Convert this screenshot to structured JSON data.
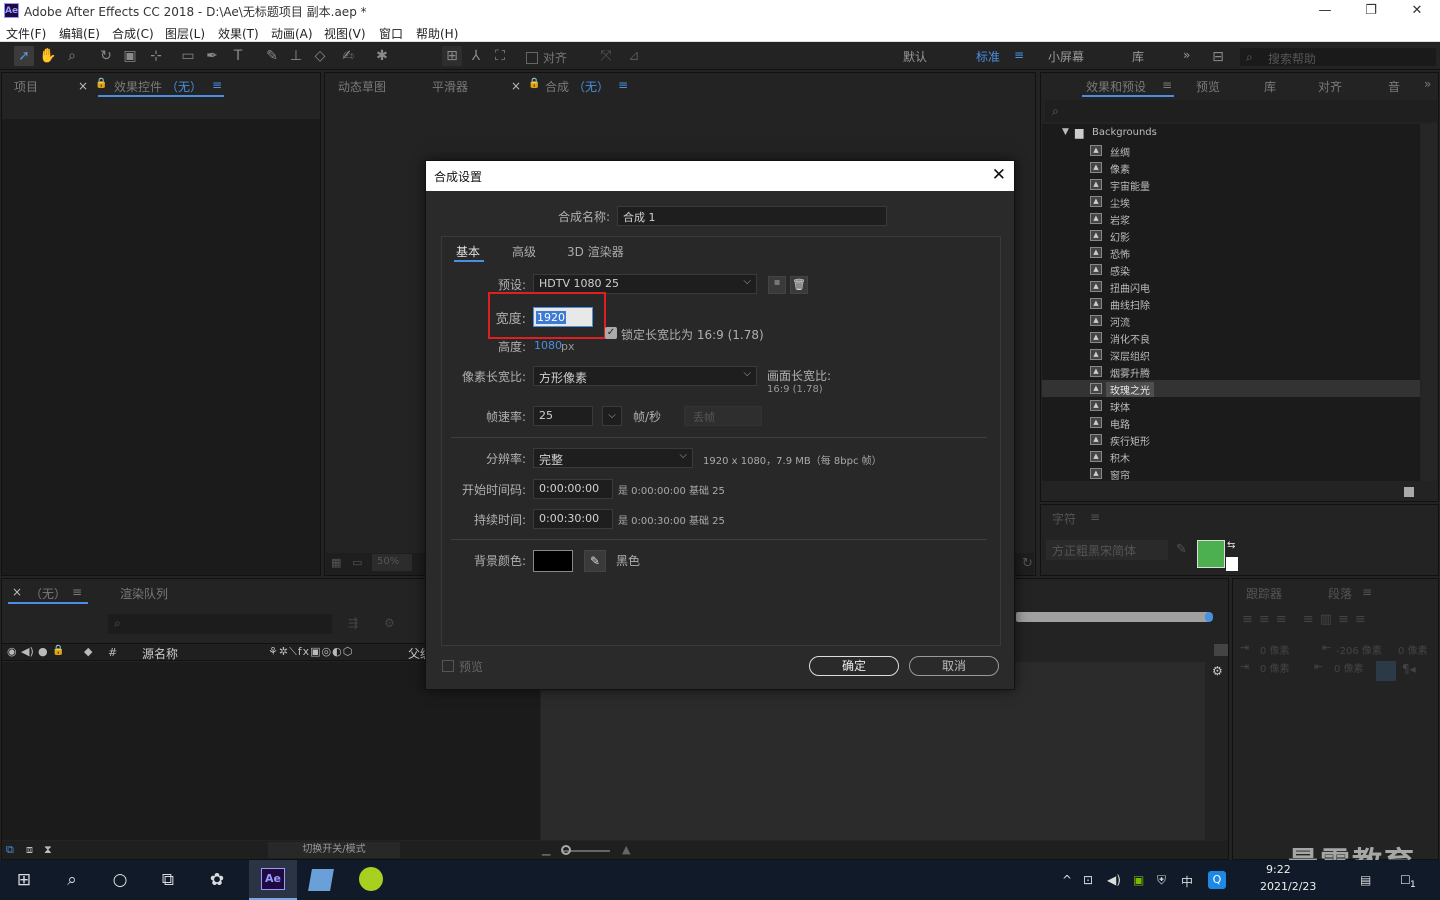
{
  "app": {
    "icon": "Ae",
    "title": "Adobe After Effects CC 2018 - D:\\Ae\\无标题项目 副本.aep *",
    "window_controls": [
      "—",
      "❐",
      "✕"
    ]
  },
  "menu": [
    "文件(F)",
    "编辑(E)",
    "合成(C)",
    "图层(L)",
    "效果(T)",
    "动画(A)",
    "视图(V)",
    "窗口",
    "帮助(H)"
  ],
  "toolbar": {
    "align_label": "对齐",
    "workspaces": [
      "默认",
      "标准",
      "小屏幕",
      "库"
    ],
    "active_workspace": "标准",
    "more": "»",
    "search_placeholder": "搜索帮助"
  },
  "project_panel": {
    "tab_project": "项目",
    "tab_effect_controls": "效果控件",
    "effect_controls_target": "（无）",
    "menu": "≡",
    "close": "×"
  },
  "viewer_panel": {
    "tabs": [
      "动态草图",
      "平滑器"
    ],
    "comp_tab": "合成",
    "comp_target": "（无）",
    "zoom": "50%"
  },
  "effects_panel": {
    "tabs": [
      "效果和预设",
      "预览",
      "库",
      "对齐",
      "音"
    ],
    "folder": "Backgrounds",
    "items": [
      "丝绸",
      "像素",
      "宇宙能量",
      "尘埃",
      "岩浆",
      "幻影",
      "恐怖",
      "感染",
      "扭曲闪电",
      "曲线扫除",
      "河流",
      "消化不良",
      "深层组织",
      "烟雾升腾",
      "玫瑰之光",
      "球体",
      "电路",
      "疾行矩形",
      "积木",
      "窗帘"
    ],
    "selected": "玫瑰之光"
  },
  "character_panel": {
    "tab": "字符",
    "font": "方正粗黑宋简体"
  },
  "timeline_panel": {
    "comp_tab": "（无）",
    "render_queue_tab": "渲染队列",
    "col_hash": "#",
    "col_source": "源名称",
    "col_parent": "父级",
    "toggle_label": "切换开关/模式"
  },
  "tracker_panel": {
    "tab_tracker": "跟踪器",
    "tab_paragraph": "段落",
    "indent_values": [
      "0 像素",
      "-206 像素",
      "0 像素",
      "0 像素",
      "0 像素"
    ]
  },
  "dialog": {
    "title": "合成设置",
    "close": "✕",
    "name_label": "合成名称:",
    "name_value": "合成 1",
    "tabs": [
      "基本",
      "高级",
      "3D 渲染器"
    ],
    "active_tab": "基本",
    "preset_label": "预设:",
    "preset_value": "HDTV 1080 25",
    "width_label": "宽度:",
    "width_value": "1920",
    "height_label": "高度:",
    "height_value": "1080",
    "height_unit": "px",
    "lock_label": "锁定长宽比为 16:9 (1.78)",
    "pixel_aspect_label": "像素长宽比:",
    "pixel_aspect_value": "方形像素",
    "frame_aspect_label": "画面长宽比:",
    "frame_aspect_value": "16:9 (1.78)",
    "frame_rate_label": "帧速率:",
    "frame_rate_value": "25",
    "frame_rate_unit": "帧/秒",
    "drop_frame": "丢帧",
    "resolution_label": "分辨率:",
    "resolution_value": "完整",
    "resolution_info": "1920 x 1080，7.9 MB（每 8bpc 帧）",
    "start_tc_label": "开始时间码:",
    "start_tc_value": "0:00:00:00",
    "start_tc_info": "是 0:00:00:00  基础 25",
    "duration_label": "持续时间:",
    "duration_value": "0:00:30:00",
    "duration_info": "是 0:00:30:00  基础 25",
    "bg_label": "背景颜色:",
    "bg_color": "#000000",
    "bg_name": "黑色",
    "preview_label": "预览",
    "ok": "确定",
    "cancel": "取消"
  },
  "taskbar": {
    "time": "9:22",
    "date": "2021/2/23",
    "ime": "中",
    "ae_label": "Ae",
    "notify_count": "1"
  },
  "watermark": "最需教育",
  "colors": {
    "accent": "#4a8fe0",
    "highlight_box": "#e02020",
    "swatch_green": "#4caf50"
  }
}
